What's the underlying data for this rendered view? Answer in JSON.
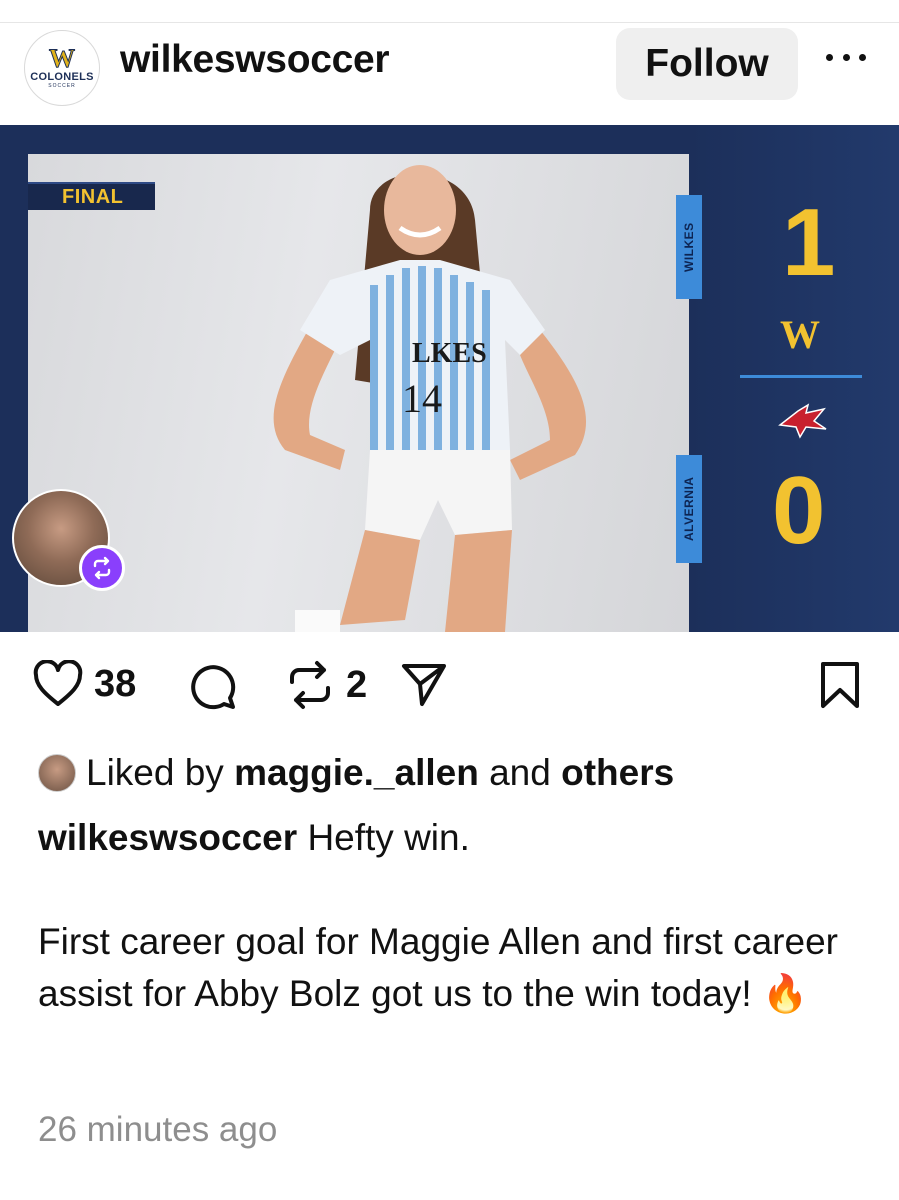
{
  "header": {
    "username": "wilkeswsoccer",
    "follow_label": "Follow",
    "logo_letter": "W",
    "logo_text": "COLONELS",
    "logo_sub": "SOCCER"
  },
  "media": {
    "final_label": "FINAL",
    "jersey_text": "WILKES",
    "jersey_number": "14",
    "home_team": "WILKES",
    "away_team": "ALVERNIA",
    "home_score": "1",
    "away_score": "0",
    "home_logo": "W",
    "colors": {
      "navy": "#1c2f5a",
      "gold": "#f2c230",
      "blue": "#3d8bd9",
      "repost": "#8a3ffc"
    }
  },
  "actions": {
    "likes_count": "38",
    "reposts_count": "2",
    "icons": [
      "heart-icon",
      "comment-icon",
      "repost-icon",
      "share-icon",
      "bookmark-icon"
    ]
  },
  "likes_line": {
    "prefix": "Liked by",
    "user": "maggie._allen",
    "middle": "and",
    "others": "others"
  },
  "caption": {
    "author": "wilkeswsoccer",
    "line1": "Hefty win.",
    "line2": "First career goal for Maggie Allen and first career assist for Abby Bolz got us to the win today! 🔥"
  },
  "timestamp": "26 minutes ago"
}
